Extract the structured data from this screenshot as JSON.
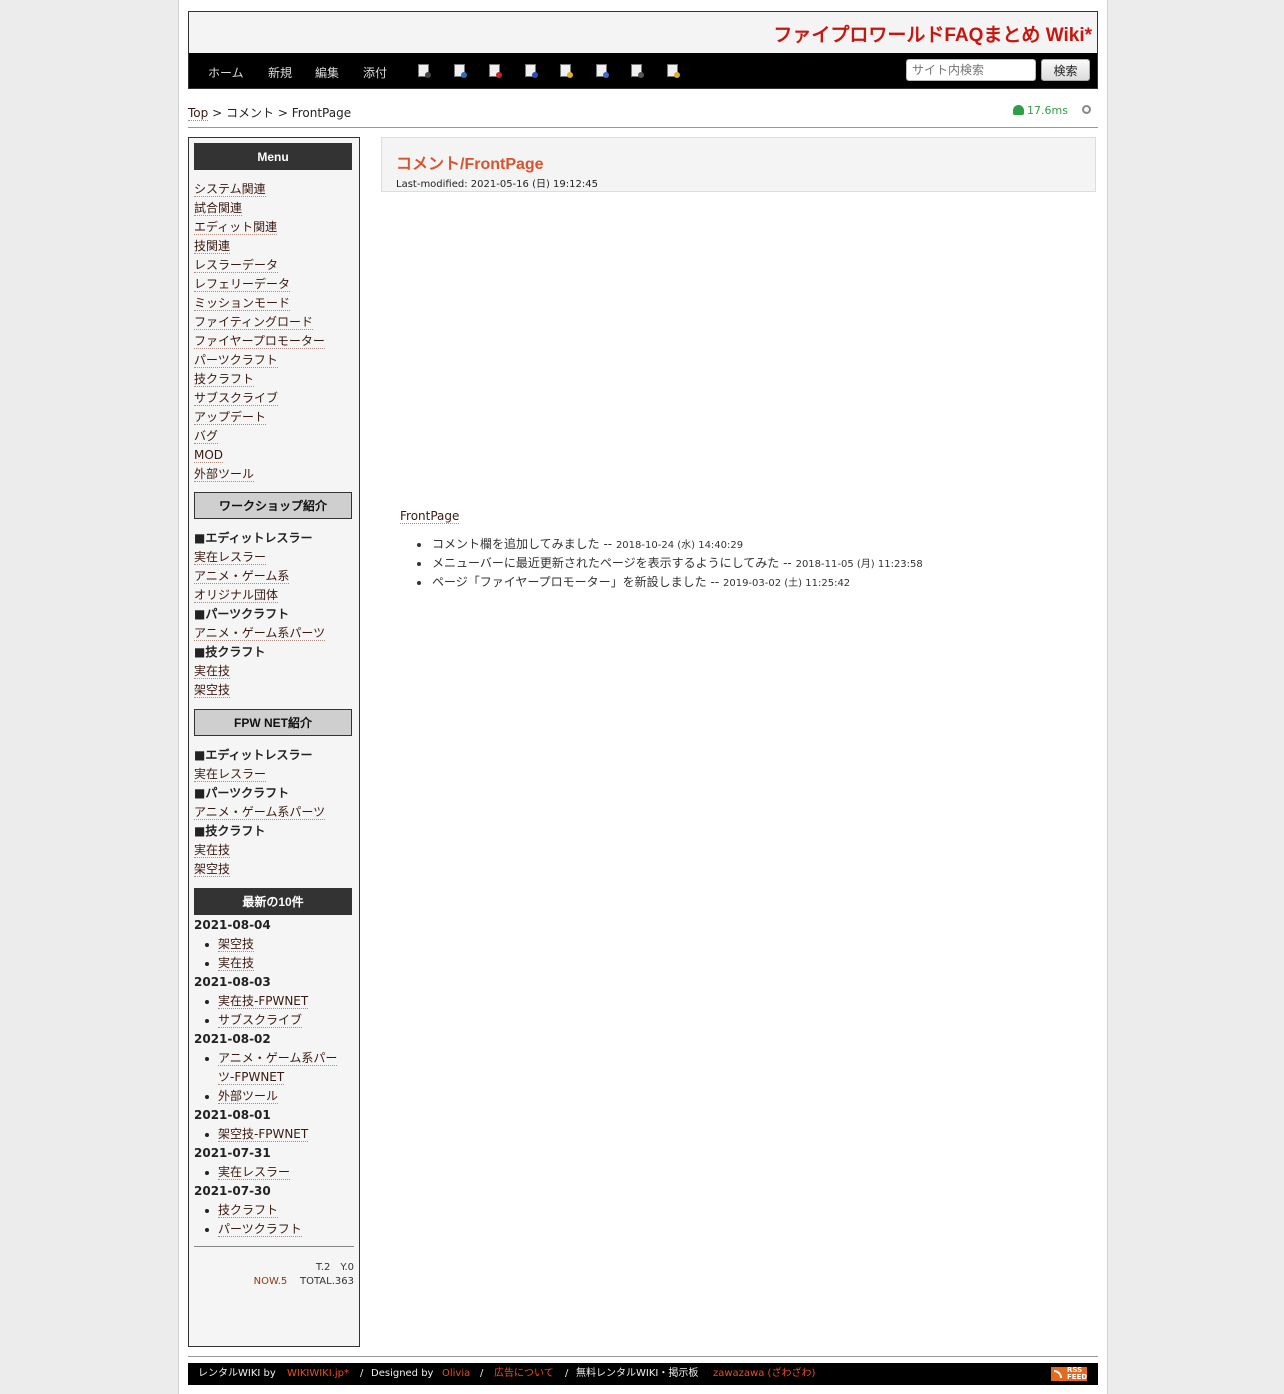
{
  "site": {
    "title": "ファイプロワールドFAQまとめ Wiki*"
  },
  "nav": {
    "links": [
      "ホーム",
      "新規",
      "編集",
      "添付"
    ],
    "tool_icons": [
      "copy-icon",
      "diff-icon",
      "backup-icon",
      "save-icon",
      "lock-icon",
      "pages-icon",
      "list-icon",
      "help-icon"
    ],
    "search_placeholder": "サイト内検索",
    "search_button": "検索"
  },
  "breadcrumb": {
    "top": "Top",
    "sep1": ">",
    "middle": "コメント",
    "sep2": ">",
    "current": "FrontPage"
  },
  "perf": {
    "time": "17.6ms"
  },
  "sidebar": {
    "menu_title": "Menu",
    "menu_items": [
      "システム関連",
      "試合関連",
      "エディット関連",
      "技関連",
      "レスラーデータ",
      "レフェリーデータ",
      "ミッションモード",
      "ファイティングロード",
      "ファイヤープロモーター",
      "パーツクラフト",
      "技クラフト",
      "サブスクライブ",
      "アップデート",
      "バグ",
      "MOD",
      "外部ツール"
    ],
    "workshop_title": "ワークショップ紹介",
    "workshop_items": [
      {
        "text": "■エディットレスラー",
        "bold": true
      },
      {
        "text": "実在レスラー",
        "bold": false
      },
      {
        "text": "アニメ・ゲーム系",
        "bold": false
      },
      {
        "text": "オリジナル団体",
        "bold": false
      },
      {
        "text": "■パーツクラフト",
        "bold": true
      },
      {
        "text": "アニメ・ゲーム系パーツ",
        "bold": false
      },
      {
        "text": "■技クラフト",
        "bold": true
      },
      {
        "text": "実在技",
        "bold": false
      },
      {
        "text": "架空技",
        "bold": false
      }
    ],
    "fpwnet_title": "FPW NET紹介",
    "fpwnet_items": [
      {
        "text": "■エディットレスラー",
        "bold": true
      },
      {
        "text": "実在レスラー",
        "bold": false
      },
      {
        "text": "■パーツクラフト",
        "bold": true
      },
      {
        "text": "アニメ・ゲーム系パーツ",
        "bold": false
      },
      {
        "text": "■技クラフト",
        "bold": true
      },
      {
        "text": "実在技",
        "bold": false
      },
      {
        "text": "架空技",
        "bold": false
      }
    ],
    "recent_title": "最新の10件",
    "recent": [
      {
        "date": "2021-08-04",
        "items": [
          "架空技",
          "実在技"
        ]
      },
      {
        "date": "2021-08-03",
        "items": [
          "実在技-FPWNET",
          "サブスクライブ"
        ]
      },
      {
        "date": "2021-08-02",
        "items": [
          "アニメ・ゲーム系パー",
          "ツ-FPWNET",
          "外部ツール"
        ]
      },
      {
        "date": "2021-08-01",
        "items": [
          "架空技-FPWNET"
        ]
      },
      {
        "date": "2021-07-31",
        "items": [
          "実在レスラー"
        ]
      },
      {
        "date": "2021-07-30",
        "items": [
          "技クラフト",
          "パーツクラフト"
        ]
      }
    ],
    "counter": {
      "ty": "T.2　Y.0",
      "now": "NOW.5",
      "total": "TOTAL.363"
    }
  },
  "main": {
    "title": "コメント/FrontPage",
    "last_modified": "Last-modified: 2021-05-16 (日) 19:12:45",
    "link": "FrontPage",
    "comments": [
      {
        "text": "コメント欄を追加してみました -- ",
        "date": "2018-10-24 (水) 14:40:29"
      },
      {
        "text": "メニューバーに最近更新されたページを表示するようにしてみた -- ",
        "date": "2018-11-05 (月) 11:23:58"
      },
      {
        "text": "ページ「ファイヤープロモーター」を新設しました -- ",
        "date": "2019-03-02 (土) 11:25:42"
      }
    ]
  },
  "footer": {
    "rental": "レンタルWIKI by",
    "wikiwiki": "WIKIWIKI.jp*",
    "sep": "/",
    "designed": "Designed by",
    "olivia": "Olivia",
    "ads": "広告について",
    "free": "無料レンタルWIKI・掲示板",
    "zawazawa": "zawazawa (ざわざわ)",
    "rss": "RSS FEED"
  },
  "colors": {
    "accent": "#c8160f",
    "title": "#d9532f",
    "perf": "#2f9e44",
    "footer_link": "#e8501c"
  }
}
